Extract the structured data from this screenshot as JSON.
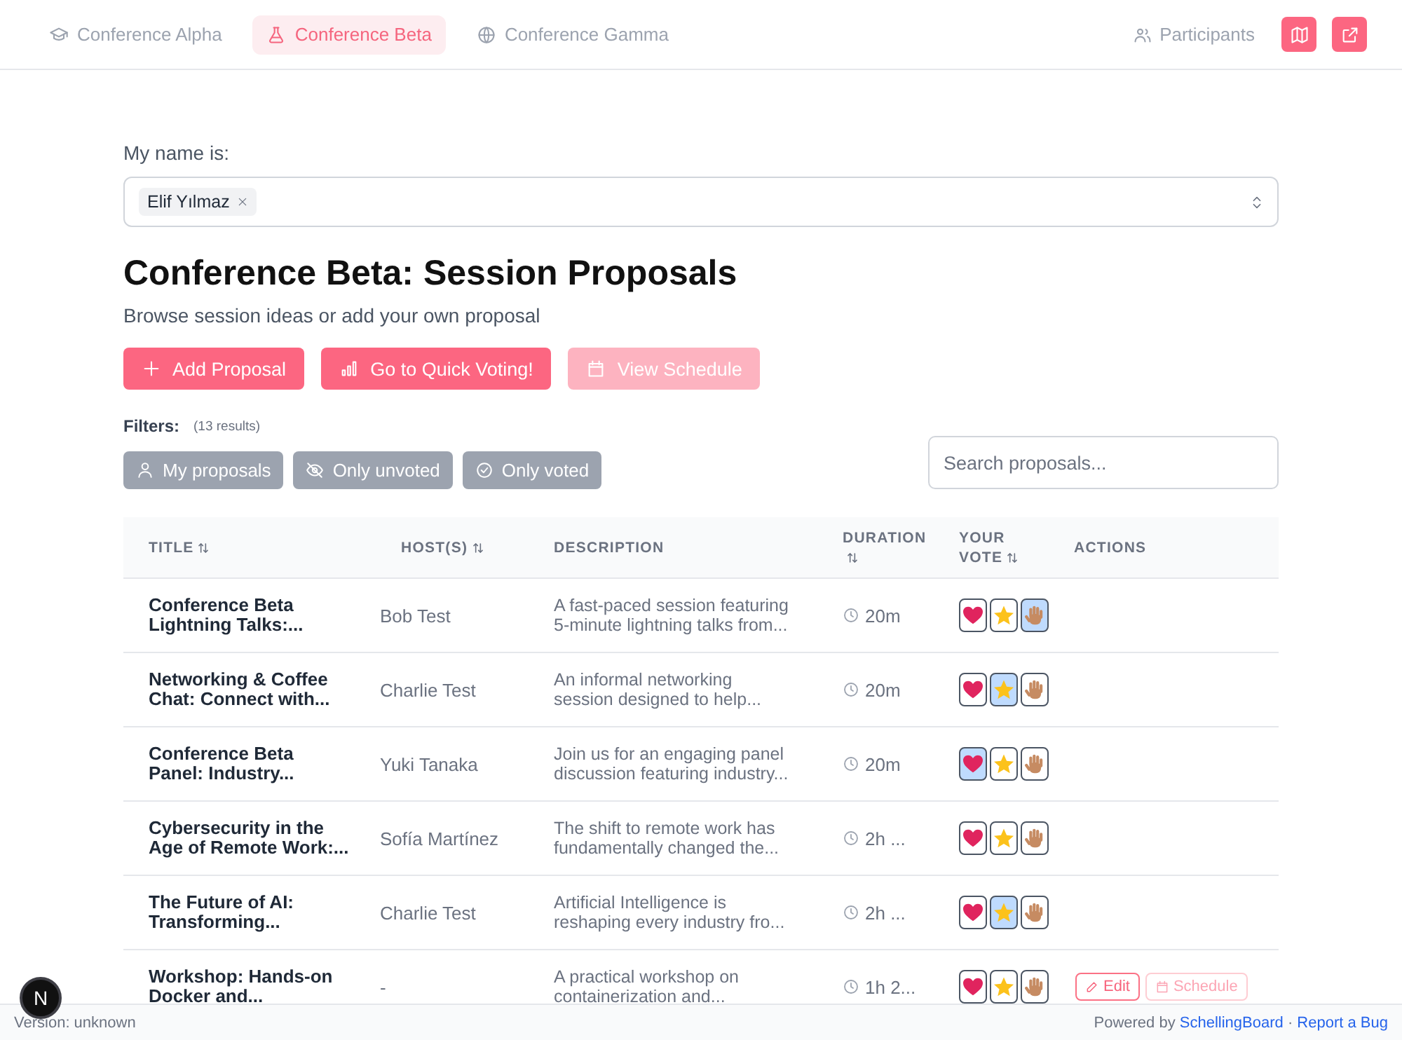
{
  "nav": {
    "tabs": [
      {
        "label": "Conference Alpha",
        "selected": false
      },
      {
        "label": "Conference Beta",
        "selected": true
      },
      {
        "label": "Conference Gamma",
        "selected": false
      }
    ],
    "participants": {
      "label": "Participants"
    }
  },
  "name_picker": {
    "label": "My name is:",
    "tags": [
      {
        "label": "Elif Yılmaz"
      }
    ]
  },
  "title": "Conference Beta: Session Proposals",
  "subtitle": "Browse session ideas or add your own proposal",
  "main_buttons": [
    {
      "label": "Add Proposal",
      "disabled": false
    },
    {
      "label": "Go to Quick Voting!",
      "disabled": false
    },
    {
      "label": "View Schedule",
      "disabled": true
    }
  ],
  "filters": {
    "label": "Filters:",
    "count": "(13 results)",
    "buttons": [
      {
        "label": "My proposals"
      },
      {
        "label": "Only unvoted"
      },
      {
        "label": "Only voted"
      }
    ],
    "search": {
      "placeholder": "Search proposals..."
    }
  },
  "table": {
    "columns": [
      {
        "label": "TITLE",
        "sortable": true
      },
      {
        "label": "HOST(S)",
        "sortable": true
      },
      {
        "label": "DESCRIPTION",
        "sortable": false
      },
      {
        "label": "DURATION",
        "sortable": true
      },
      {
        "label": "YOUR VOTE",
        "sortable": true
      },
      {
        "label": "ACTIONS",
        "sortable": false
      }
    ],
    "rows": [
      {
        "title": "Conference Beta Lightning Talks:...",
        "hosts": "Bob Test",
        "description": "A fast-paced session featuring 5-minute lightning talks from...",
        "duration": "20m",
        "votes": [
          {
            "selected": false
          },
          {
            "selected": false
          },
          {
            "selected": true
          }
        ]
      },
      {
        "title": "Networking & Coffee Chat: Connect with...",
        "hosts": "Charlie Test",
        "description": "An informal networking session designed to help...",
        "duration": "20m",
        "votes": [
          {
            "selected": false
          },
          {
            "selected": true
          },
          {
            "selected": false
          }
        ]
      },
      {
        "title": "Conference Beta Panel: Industry...",
        "hosts": "Yuki Tanaka",
        "description": "Join us for an engaging panel discussion featuring industry...",
        "duration": "20m",
        "votes": [
          {
            "selected": true
          },
          {
            "selected": false
          },
          {
            "selected": false
          }
        ]
      },
      {
        "title": "Cybersecurity in the Age of Remote Work:...",
        "hosts": "Sofía Martínez",
        "description": "The shift to remote work has fundamentally changed the...",
        "duration": "2h ...",
        "votes": [
          {
            "selected": false
          },
          {
            "selected": false
          },
          {
            "selected": false
          }
        ]
      },
      {
        "title": "The Future of AI: Transforming...",
        "hosts": "Charlie Test",
        "description": "Artificial Intelligence is reshaping every industry fro...",
        "duration": "2h ...",
        "votes": [
          {
            "selected": false
          },
          {
            "selected": true
          },
          {
            "selected": false
          }
        ]
      },
      {
        "title": "Workshop: Hands-on Docker and...",
        "hosts": "-",
        "description": "A practical workshop on containerization and...",
        "duration": "1h 2...",
        "votes": [
          {
            "selected": false
          },
          {
            "selected": false
          },
          {
            "selected": false
          }
        ],
        "actions": [
          {
            "kind": "edit",
            "label": "Edit",
            "disabled": false
          },
          {
            "kind": "schedule",
            "label": "Schedule",
            "disabled": true
          }
        ]
      }
    ]
  },
  "dev_badge": {
    "label": "N"
  },
  "footer": {
    "version": "Version: unknown",
    "powered_by": "Powered by",
    "links": [
      {
        "label": "SchellingBoard"
      },
      {
        "label": "Report a Bug"
      }
    ],
    "separator": "·"
  }
}
